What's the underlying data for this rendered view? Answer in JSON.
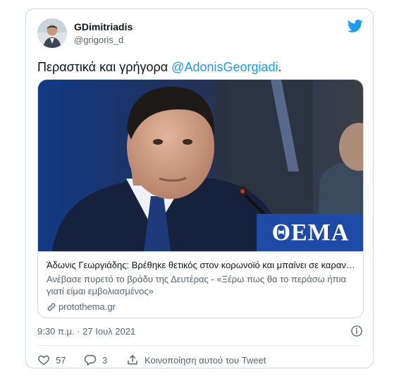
{
  "author": {
    "display_name": "GDimitriadis",
    "handle": "@grigoris_d"
  },
  "tweet": {
    "text_before": "Περαστικά και γρήγορα ",
    "mention": "@AdonisGeorgiadi",
    "text_after": "."
  },
  "link_card": {
    "image_logo": "ΘΕΜΑ",
    "title": "Άδωνις Γεωργιάδης: Βρέθηκε θετικός στον κορωνοϊό και μπαίνει σε καραντίνα",
    "description": "Ανέβασε πυρετό το βράδυ της Δευτέρας - «Ξέρω πως θα το περάσω ήπια γιατί είμαι εμβολιασμένος»",
    "domain": "protothema.gr"
  },
  "timestamp": "9:30 π.μ. · 27 Ιουλ 2021",
  "actions": {
    "likes": "57",
    "replies": "3",
    "share_label": "Κοινοποίηση αυτού του Tweet"
  },
  "colors": {
    "accent": "#1d9bf0",
    "text": "#0f1419",
    "muted": "#536471",
    "border": "#cfd9de",
    "logo_bg": "#1e4aa8"
  },
  "icons": [
    "twitter-bird-icon",
    "link-icon",
    "info-icon",
    "heart-icon",
    "reply-icon",
    "share-icon"
  ]
}
